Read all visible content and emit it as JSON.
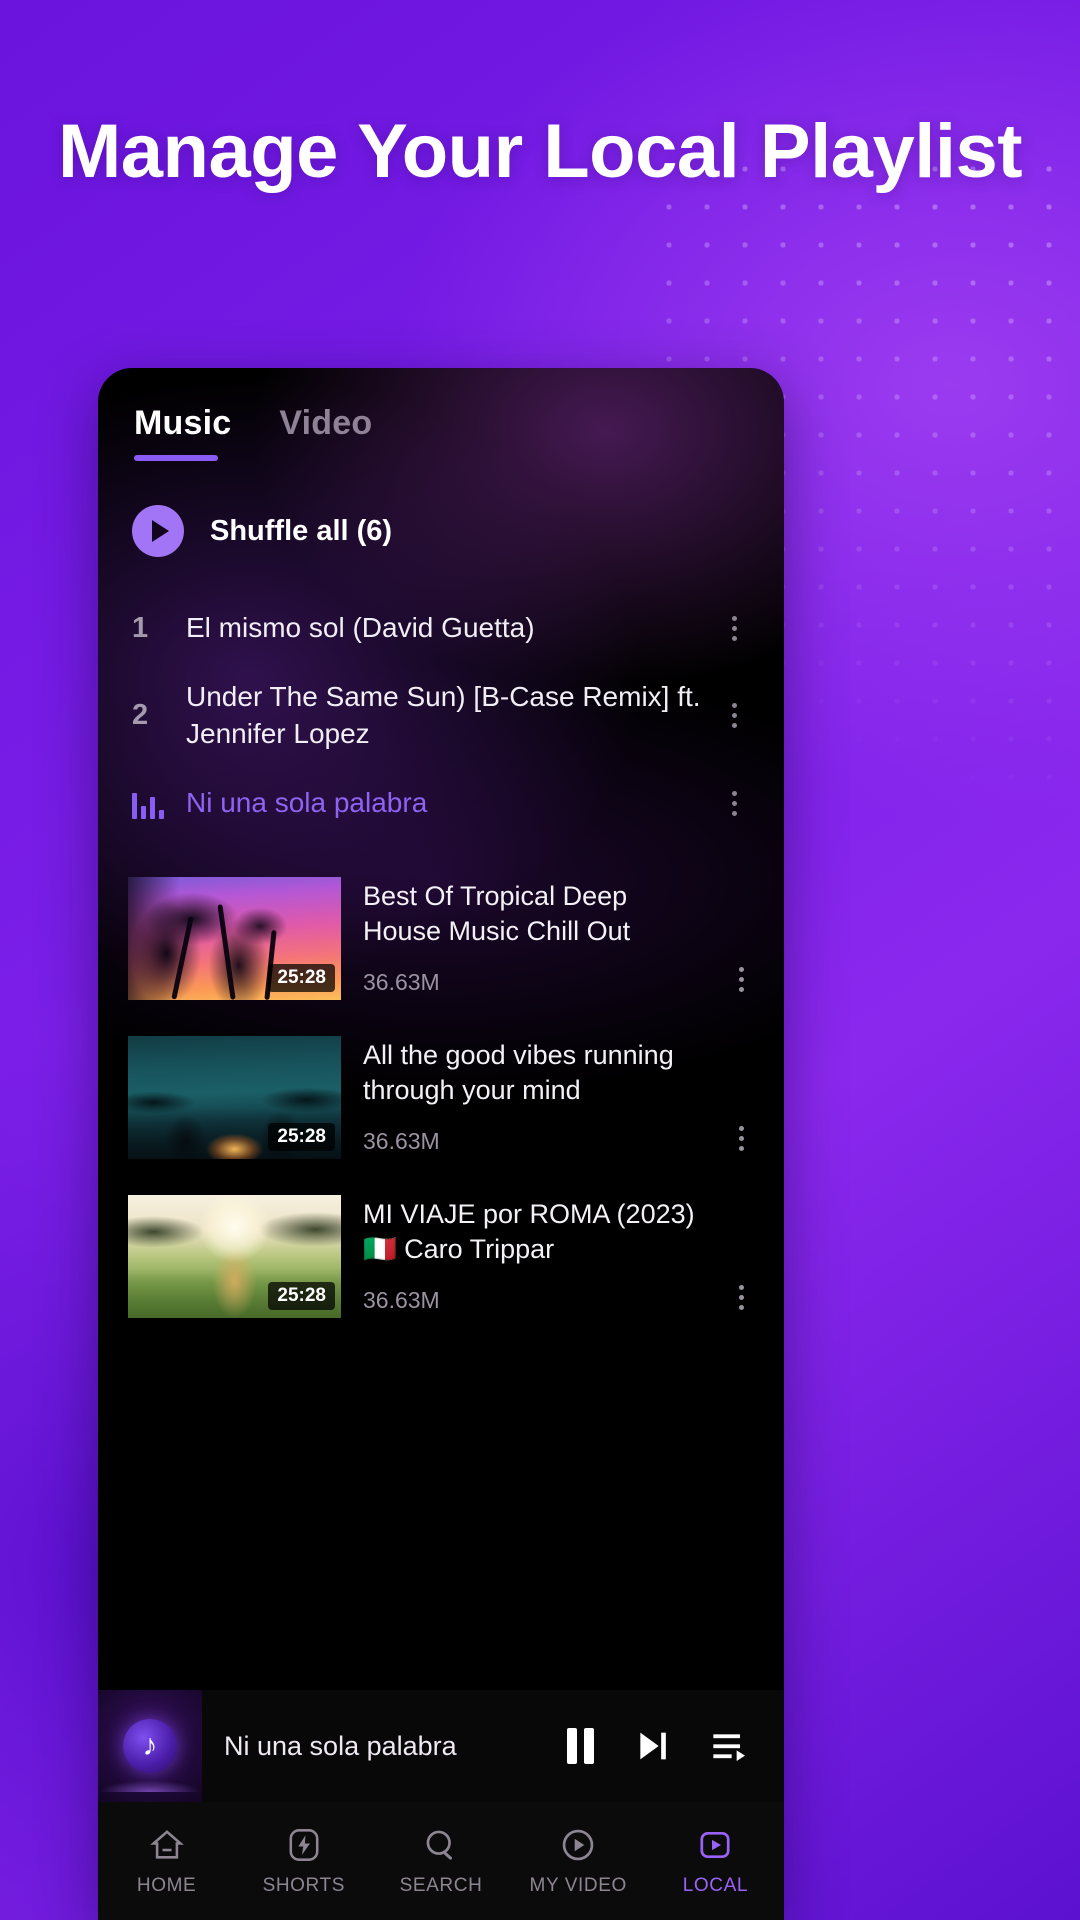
{
  "headline": "Manage Your Local Playlist",
  "theme": {
    "background_purple": "#7a1ee8",
    "accent_purple": "#8a5cf6",
    "app_background": "#000000",
    "playing_track_color": "#8f63f2",
    "active_nav_color": "#9a62f7"
  },
  "app": {
    "tabs": [
      {
        "label": "Music",
        "active": true
      },
      {
        "label": "Video",
        "active": false
      }
    ],
    "shuffle": {
      "label": "Shuffle all (6)",
      "icon": "play-icon"
    },
    "songs": [
      {
        "index": "1",
        "title": "El mismo sol (David Guetta)",
        "playing": false
      },
      {
        "index": "2",
        "title": "Under The Same Sun) [B-Case Remix] ft. Jennifer Lopez",
        "playing": false
      },
      {
        "index": "",
        "title": "Ni una sola palabra",
        "playing": true
      }
    ],
    "videos": [
      {
        "title": "Best Of Tropical Deep House Music Chill Out",
        "duration": "25:28",
        "views": "36.63M",
        "thumbnail": "tropical-sunset-palms"
      },
      {
        "title": "All the good vibes running through your mind",
        "duration": "25:28",
        "views": "36.63M",
        "thumbnail": "night-beach-campfire"
      },
      {
        "title": "MI VIAJE por ROMA (2023) 🇮🇹 Caro Trippar",
        "duration": "25:28",
        "views": "36.63M",
        "thumbnail": "golden-meadow-sunset"
      }
    ],
    "mini_player": {
      "title": "Ni una sola palabra",
      "artwork_icon": "music-note-icon",
      "controls": [
        {
          "name": "pause-button",
          "icon": "pause-icon"
        },
        {
          "name": "next-button",
          "icon": "skip-next-icon"
        },
        {
          "name": "queue-button",
          "icon": "playlist-queue-icon"
        }
      ]
    },
    "bottom_nav": [
      {
        "label": "HOME",
        "icon": "home-icon",
        "active": false
      },
      {
        "label": "SHORTS",
        "icon": "lightning-bolt-icon",
        "active": false
      },
      {
        "label": "SEARCH",
        "icon": "search-icon",
        "active": false
      },
      {
        "label": "MY VIDEO",
        "icon": "play-circle-icon",
        "active": false
      },
      {
        "label": "LOCAL",
        "icon": "local-library-icon",
        "active": true
      }
    ]
  }
}
